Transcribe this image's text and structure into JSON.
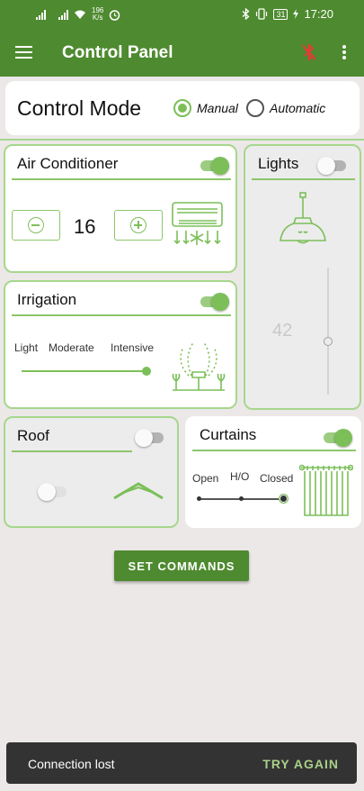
{
  "status_bar": {
    "net_speed_value": "196",
    "net_speed_unit": "K/s",
    "battery": "31",
    "time": "17:20",
    "icons": [
      "signal-icon",
      "signal-icon",
      "wifi-icon",
      "alarm-icon",
      "bluetooth-icon",
      "vibrate-icon",
      "battery-icon",
      "charging-icon"
    ]
  },
  "app_bar": {
    "title": "Control Panel",
    "icons": [
      "menu-icon",
      "bluetooth-disabled-icon",
      "more-vert-icon"
    ],
    "bluetooth_color": "#e53935"
  },
  "control_mode": {
    "title": "Control Mode",
    "options": [
      {
        "label": "Manual",
        "checked": true
      },
      {
        "label": "Automatic",
        "checked": false
      }
    ]
  },
  "air_conditioner": {
    "title": "Air Conditioner",
    "enabled": true,
    "temperature": "16",
    "icons": [
      "minus-circle-icon",
      "plus-circle-icon",
      "air-conditioner-icon"
    ]
  },
  "lights": {
    "title": "Lights",
    "enabled": false,
    "value": "42",
    "icons": [
      "ceiling-lamp-icon"
    ]
  },
  "irrigation": {
    "title": "Irrigation",
    "enabled": true,
    "levels": [
      "Light",
      "Moderate",
      "Intensive"
    ],
    "selected_level": "Intensive",
    "icons": [
      "sprinkler-icon"
    ]
  },
  "roof": {
    "title": "Roof",
    "enabled": false,
    "inner_toggle_on": false,
    "icons": [
      "roof-icon"
    ]
  },
  "curtains": {
    "title": "Curtains",
    "enabled": true,
    "positions": [
      "Open",
      "H/O",
      "Closed"
    ],
    "selected_position": "Closed",
    "icons": [
      "curtain-icon"
    ]
  },
  "actions": {
    "set_commands": "SET COMMANDS"
  },
  "snackbar": {
    "message": "Connection lost",
    "action": "TRY AGAIN"
  },
  "colors": {
    "primary": "#4e8a2f",
    "accent": "#7cbf59",
    "card_border": "#a7d78d",
    "background": "#ece8e8"
  }
}
